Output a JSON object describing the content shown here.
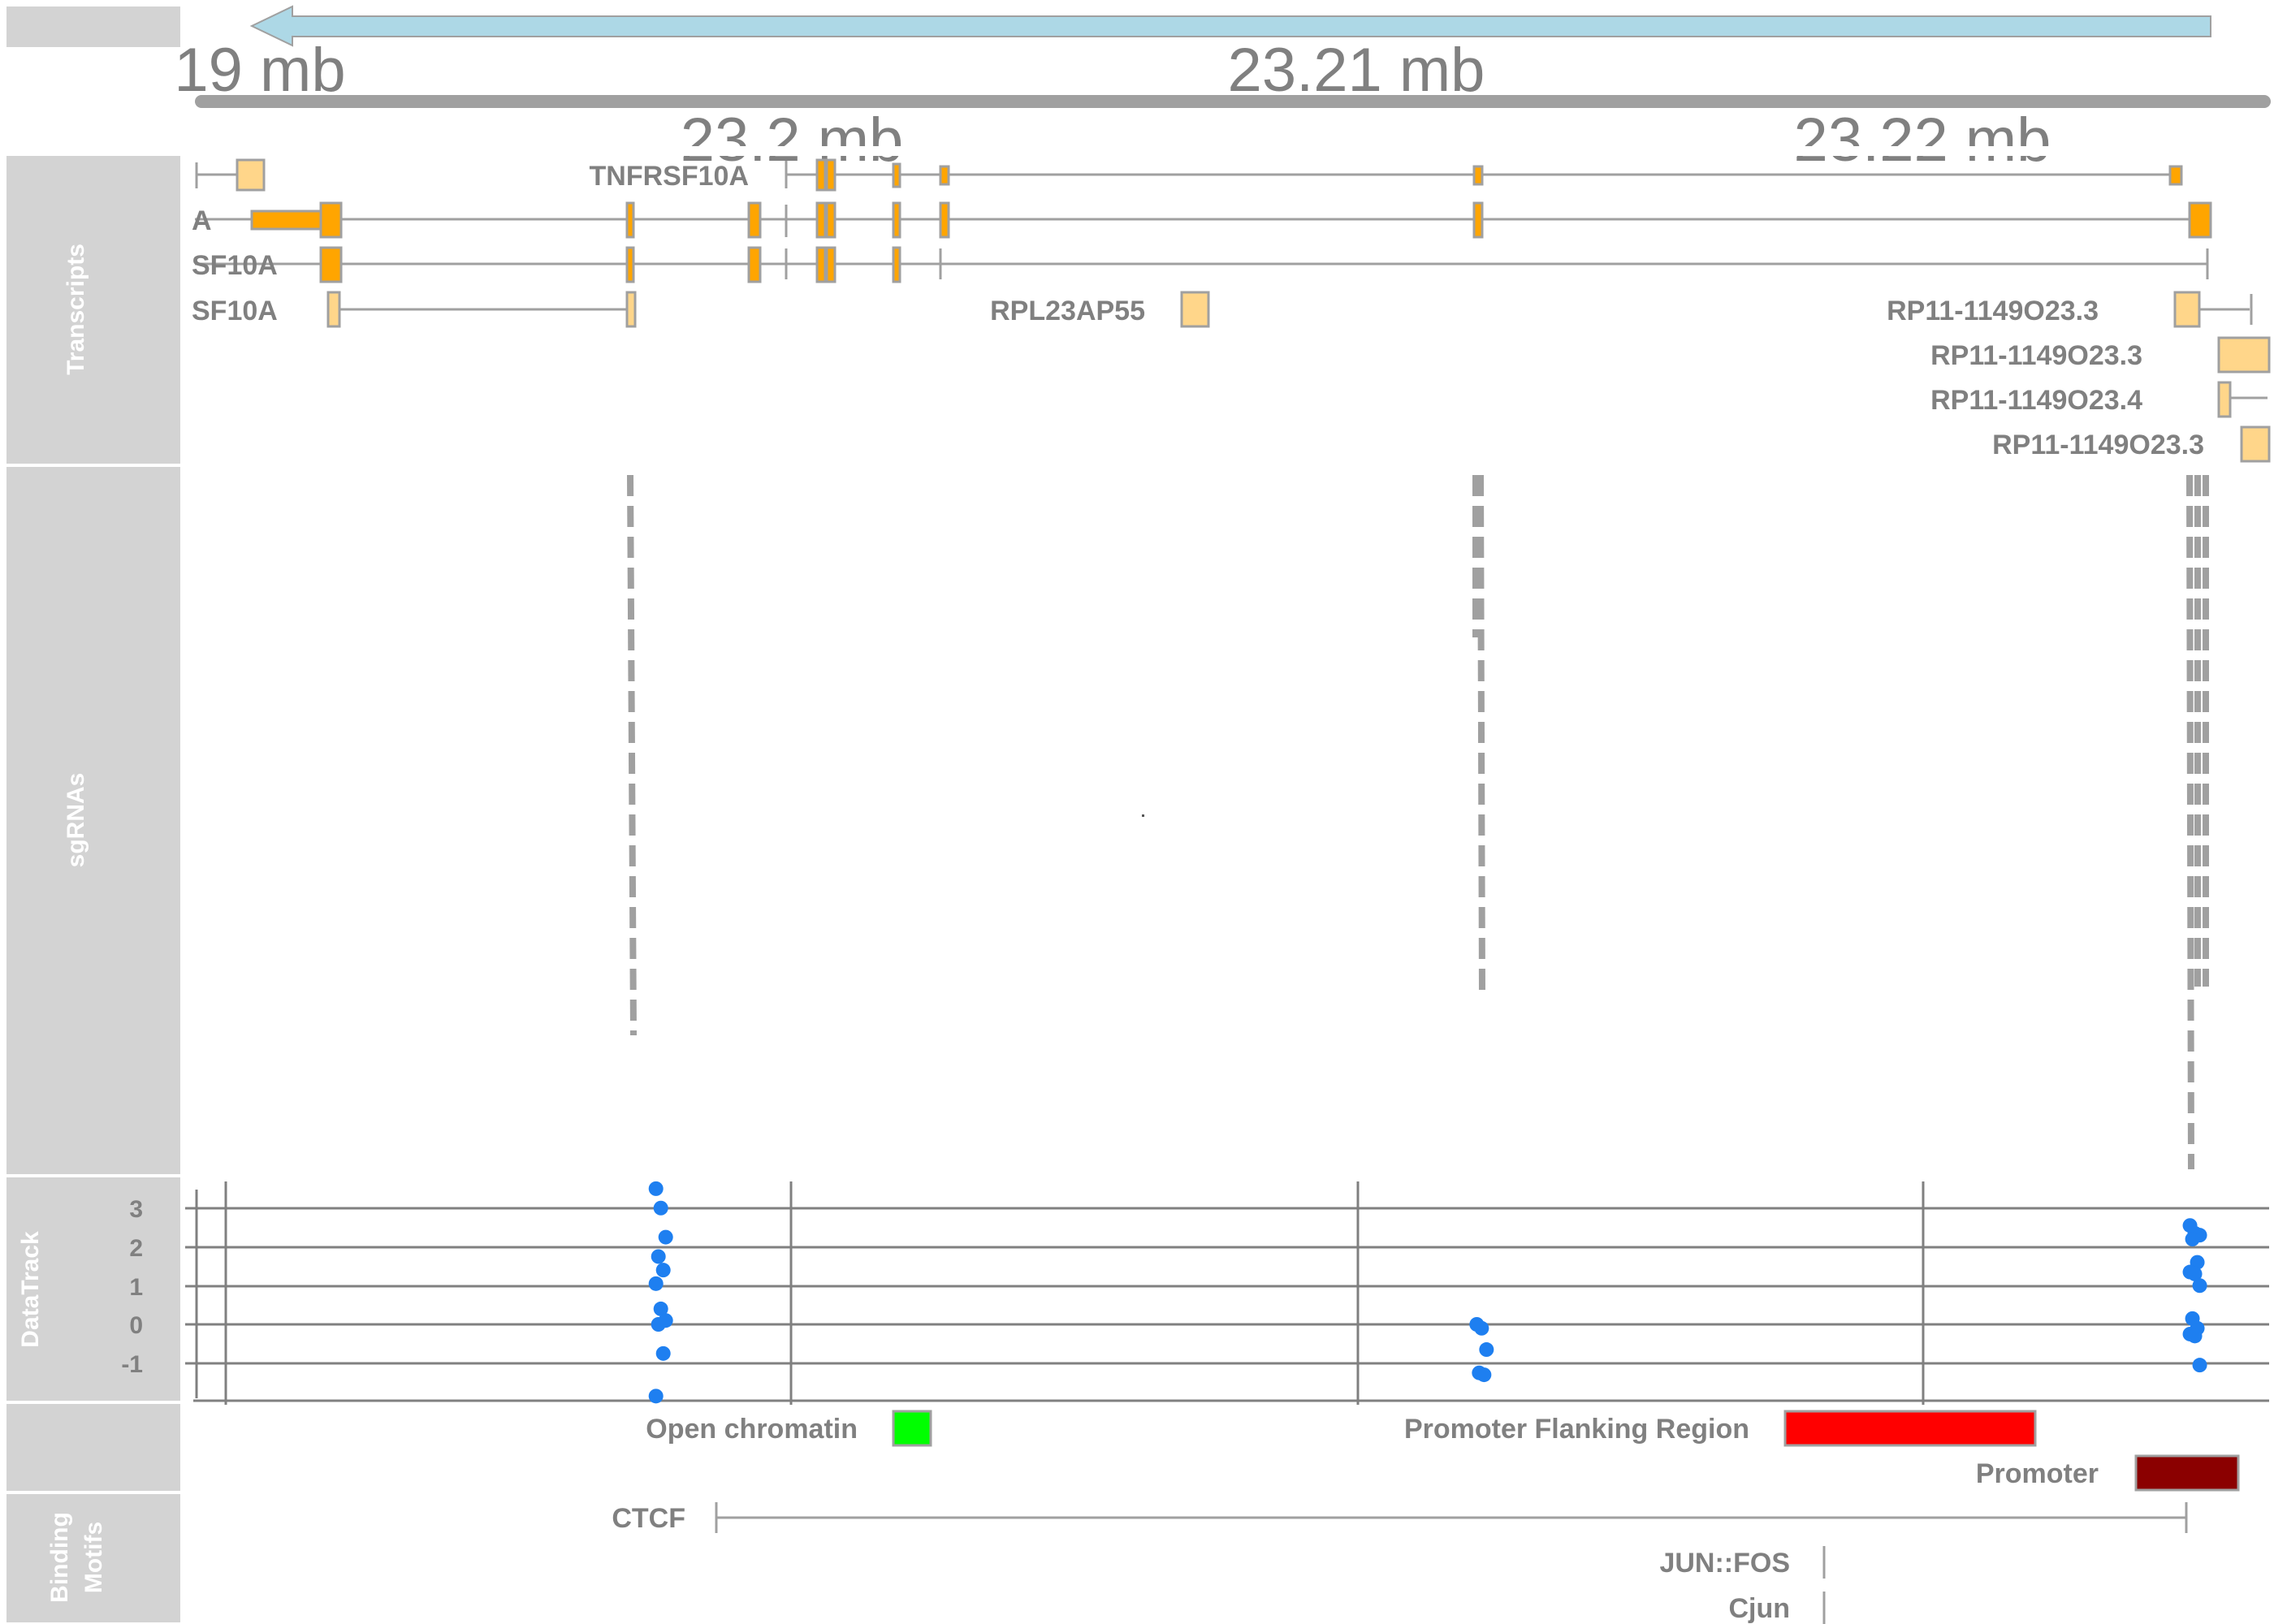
{
  "colors": {
    "panel": "#d3d3d3",
    "line": "#a0a0a0",
    "utr": "#ffd68a",
    "cds": "#ffa500",
    "strand_arrow": "#add8e6",
    "points": "#1e7ff0",
    "open_chromatin": "#00ff00",
    "promoter_flank": "#ff0000",
    "promoter": "#8b0000"
  },
  "tracks": {
    "transcripts": "Transcripts",
    "sgrnas": "sgRNAs",
    "datatrack": "DataTrack",
    "binding_motifs_line1": "Binding",
    "binding_motifs_line2": "Motifs"
  },
  "axis": {
    "tick_labels_top": [
      "19 mb",
      "23.21 mb"
    ],
    "tick_labels_bottom": [
      "23.2 mb",
      "23.22 mb"
    ]
  },
  "genes": {
    "tnfrsf10a": "TNFRSF10A",
    "a_label": "A",
    "sf10a_1": "SF10A",
    "sf10a_2": "SF10A",
    "rpl23ap55": "RPL23AP55",
    "rp11_a": "RP11-1149O23.3",
    "rp11_b": "RP11-1149O23.3",
    "rp11_c": "RP11-1149O23.4",
    "rp11_d": "RP11-1149O23.3"
  },
  "regulatory": {
    "open_chromatin": "Open chromatin",
    "promoter_flanking": "Promoter Flanking Region",
    "promoter": "Promoter"
  },
  "motifs": {
    "ctcf": "CTCF",
    "jun_fos": "JUN::FOS",
    "cjun": "Cjun"
  },
  "chart_data": {
    "type": "scatter",
    "ylim": [
      -2,
      3.5
    ],
    "yticks": [
      3,
      2,
      1,
      0,
      -1
    ],
    "grid": true,
    "groups": [
      {
        "x_mb": 23.1977,
        "values": [
          3.5,
          3.0,
          2.25,
          1.75,
          1.4,
          1.05,
          0.4,
          0.1,
          0.0,
          -0.75,
          -1.85
        ]
      },
      {
        "x_mb": 23.2122,
        "values": [
          0.0,
          -0.1,
          -0.65,
          -1.25,
          -1.3
        ]
      },
      {
        "x_mb": 23.2248,
        "values": [
          2.55,
          2.35,
          2.3,
          2.2,
          1.6,
          1.35,
          1.3,
          1.0,
          0.15,
          -0.1,
          -0.25,
          -0.3,
          -1.05
        ]
      }
    ]
  }
}
